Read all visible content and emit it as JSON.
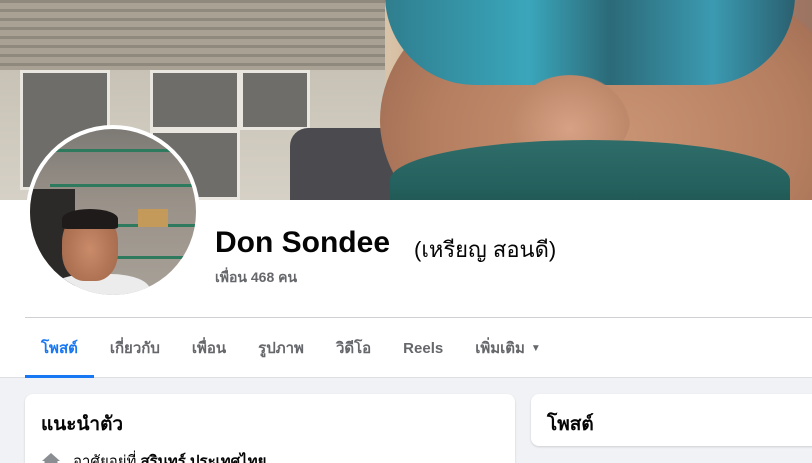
{
  "profile": {
    "name": "Don Sondee",
    "alt_name": "(เหรียญ สอนดี)",
    "friends_text": "เพื่อน 468 คน"
  },
  "tabs": [
    {
      "label": "โพสต์",
      "active": true
    },
    {
      "label": "เกี่ยวกับ",
      "active": false
    },
    {
      "label": "เพื่อน",
      "active": false
    },
    {
      "label": "รูปภาพ",
      "active": false
    },
    {
      "label": "วิดีโอ",
      "active": false
    },
    {
      "label": "Reels",
      "active": false
    },
    {
      "label": "เพิ่มเติม",
      "active": false,
      "icon": "caret-down-icon"
    }
  ],
  "intro": {
    "title": "แนะนำตัว",
    "location_prefix": "อาศัยอยู่ที่",
    "location_city": "สุรินทร์ ประเทศไทย",
    "icon": "home-icon"
  },
  "posts": {
    "title": "โพสต์"
  },
  "colors": {
    "accent": "#1877f2",
    "muted": "#65676b",
    "text": "#050505",
    "background": "#f0f2f5"
  }
}
